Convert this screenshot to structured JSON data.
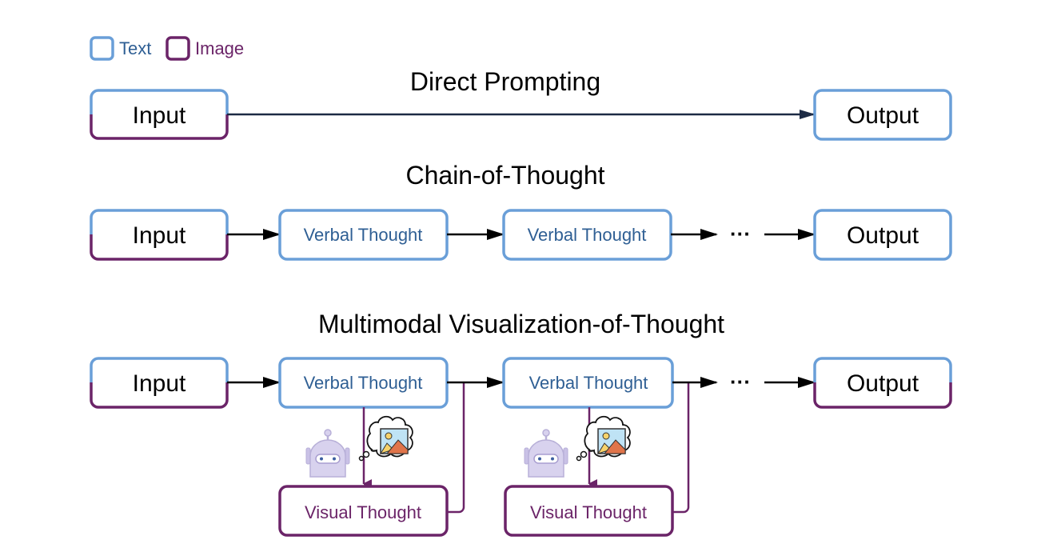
{
  "legend": {
    "text_label": "Text",
    "image_label": "Image"
  },
  "colors": {
    "text": "#6a9fd8",
    "image": "#6b2468",
    "arrow": "#000000"
  },
  "sections": {
    "direct": {
      "title": "Direct Prompting",
      "input": "Input",
      "output": "Output"
    },
    "cot": {
      "title": "Chain-of-Thought",
      "input": "Input",
      "thought1": "Verbal Thought",
      "thought2": "Verbal Thought",
      "ellipsis": "···",
      "output": "Output"
    },
    "mvot": {
      "title": "Multimodal Visualization-of-Thought",
      "input": "Input",
      "verbal1": "Verbal Thought",
      "verbal2": "Verbal Thought",
      "visual1": "Visual Thought",
      "visual2": "Visual Thought",
      "ellipsis": "···",
      "output": "Output"
    }
  },
  "icons": [
    "robot-icon",
    "thought-bubble-image-icon"
  ]
}
